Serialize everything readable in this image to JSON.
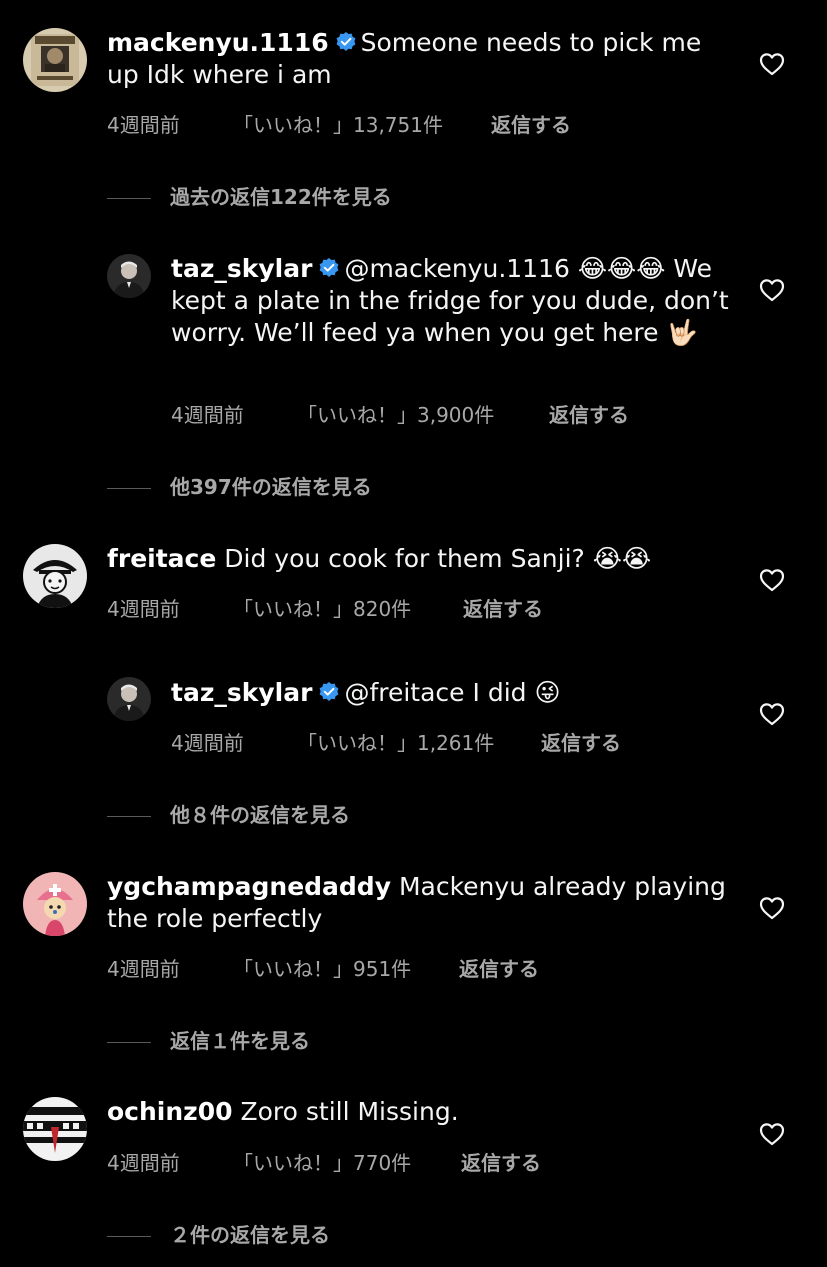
{
  "comments": [
    {
      "username": "mackenyu.1116",
      "verified": true,
      "text": "Someone needs to pick me up Idk where i am",
      "time": "4週間前",
      "likes": "「いいね！」13,751件",
      "reply": "返信する",
      "view_replies": "過去の返信122件を見る",
      "avatar_icon": "wanted-poster-avatar"
    },
    {
      "username": "taz_skylar",
      "verified": true,
      "text": "@mackenyu.1116 😂😂😂 We kept a plate in the fridge for you dude, don’t worry. We’ll feed ya when you get here 🤟🏻",
      "time": "4週間前",
      "likes": "「いいね！」3,900件",
      "reply": "返信する",
      "view_replies": "他397件の返信を見る",
      "avatar_icon": "person-avatar"
    },
    {
      "username": "freitace",
      "verified": false,
      "text": "Did you cook for them Sanji? 😭😭",
      "time": "4週間前",
      "likes": "「いいね！」820件",
      "reply": "返信する",
      "avatar_icon": "manga-avatar"
    },
    {
      "username": "taz_skylar",
      "verified": true,
      "text": "@freitace I did 😜",
      "time": "4週間前",
      "likes": "「いいね！」1,261件",
      "reply": "返信する",
      "view_replies": "他８件の返信を見る",
      "avatar_icon": "person-avatar"
    },
    {
      "username": "ygchampagnedaddy",
      "verified": false,
      "text": "Mackenyu already playing the role perfectly",
      "time": "4週間前",
      "likes": "「いいね！」951件",
      "reply": "返信する",
      "view_replies": "返信１件を見る",
      "avatar_icon": "chopper-avatar"
    },
    {
      "username": "ochinz00",
      "verified": false,
      "text": "Zoro still Missing.",
      "time": "4週間前",
      "likes": "「いいね！」770件",
      "reply": "返信する",
      "view_replies": "２件の返信を見る",
      "avatar_icon": "we-are-tokyo-avatar"
    }
  ],
  "colors": {
    "background": "#000000",
    "text": "#f5f5f5",
    "meta": "#a8a8a8",
    "verified": "#3897f0"
  }
}
